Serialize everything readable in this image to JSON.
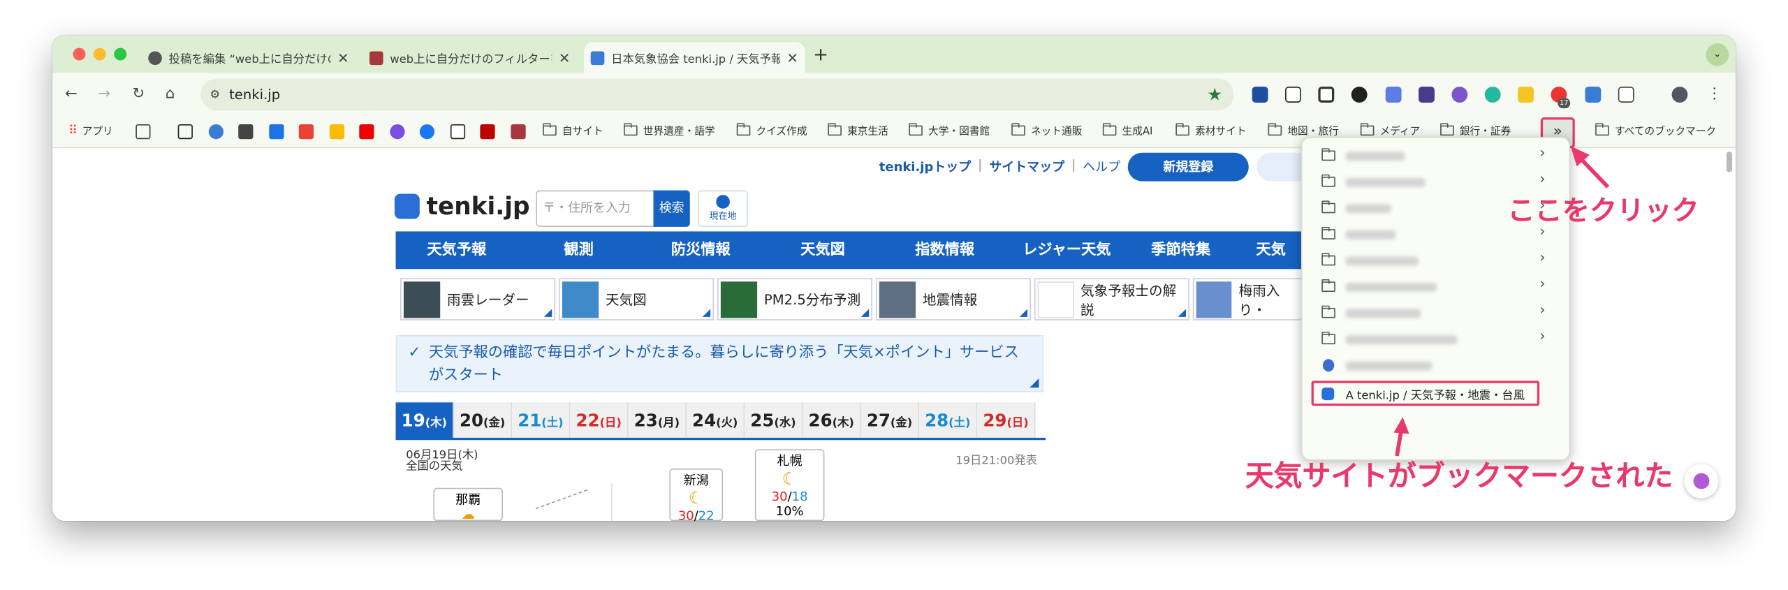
{
  "colors": {
    "accent": "#e8386c",
    "nav": "#1662c2",
    "tab_bar": "#ddeed3"
  },
  "tabs": [
    {
      "title": "投稿を編集 “web上に自分だけのフィルター",
      "close": "✕"
    },
    {
      "title": "web上に自分だけのフィルターを",
      "close": "✕"
    },
    {
      "title": "日本気象協会 tenki.jp / 天気予報",
      "close": "✕"
    }
  ],
  "new_tab": "+",
  "toolbar": {
    "url": "tenki.jp",
    "ext_badge": "17"
  },
  "bookmarks": {
    "apps": "アプリ",
    "folders": [
      "自サイト",
      "世界遺産・語学",
      "クイズ作成",
      "東京生活",
      "大学・図書館",
      "ネット通販",
      "生成AI",
      "素材サイト",
      "地図・旅行",
      "メディア",
      "銀行・証券"
    ],
    "overflow": "»",
    "all": "すべてのブックマーク"
  },
  "site": {
    "header_links": [
      "tenki.jpトップ",
      "サイトマップ",
      "ヘルプ"
    ],
    "signup": "新規登録",
    "logo": "tenki.jp",
    "search_placeholder": "〒・住所を入力",
    "search_button": "検索",
    "location": "現在地",
    "nav": [
      "天気予報",
      "観測",
      "防災情報",
      "天気図",
      "指数情報",
      "レジャー天気",
      "季節特集",
      "天気"
    ],
    "tiles": [
      "雨雲レーダー",
      "天気図",
      "PM2.5分布予測",
      "地震情報",
      "気象予報士の解説",
      "梅雨入り・"
    ],
    "notice": "天気予報の確認で毎日ポイントがたまる。暮らしに寄り添う「天気×ポイント」サービスがスタート",
    "dates": [
      {
        "d": "19",
        "w": "(木)"
      },
      {
        "d": "20",
        "w": "(金)"
      },
      {
        "d": "21",
        "w": "(土)"
      },
      {
        "d": "22",
        "w": "(日)"
      },
      {
        "d": "23",
        "w": "(月)"
      },
      {
        "d": "24",
        "w": "(火)"
      },
      {
        "d": "25",
        "w": "(水)"
      },
      {
        "d": "26",
        "w": "(木)"
      },
      {
        "d": "27",
        "w": "(金)"
      },
      {
        "d": "28",
        "w": "(土)"
      },
      {
        "d": "29",
        "w": "(日)"
      }
    ],
    "forecast_date": "06月19日(木)",
    "forecast_title": "全国の天気",
    "issued": "19日21:00発表",
    "cities": [
      {
        "name": "札幌",
        "high": "30",
        "low": "18",
        "pop": "10%"
      },
      {
        "name": "新潟",
        "high": "30",
        "low": "22"
      },
      {
        "name": "那覇"
      }
    ],
    "slash": "/"
  },
  "menu": {
    "bookmarked_item": "A tenki.jp / 天気予報・地震・台風"
  },
  "annotations": {
    "click_here": "ここをクリック",
    "bookmarked": "天気サイトがブックマークされた"
  }
}
